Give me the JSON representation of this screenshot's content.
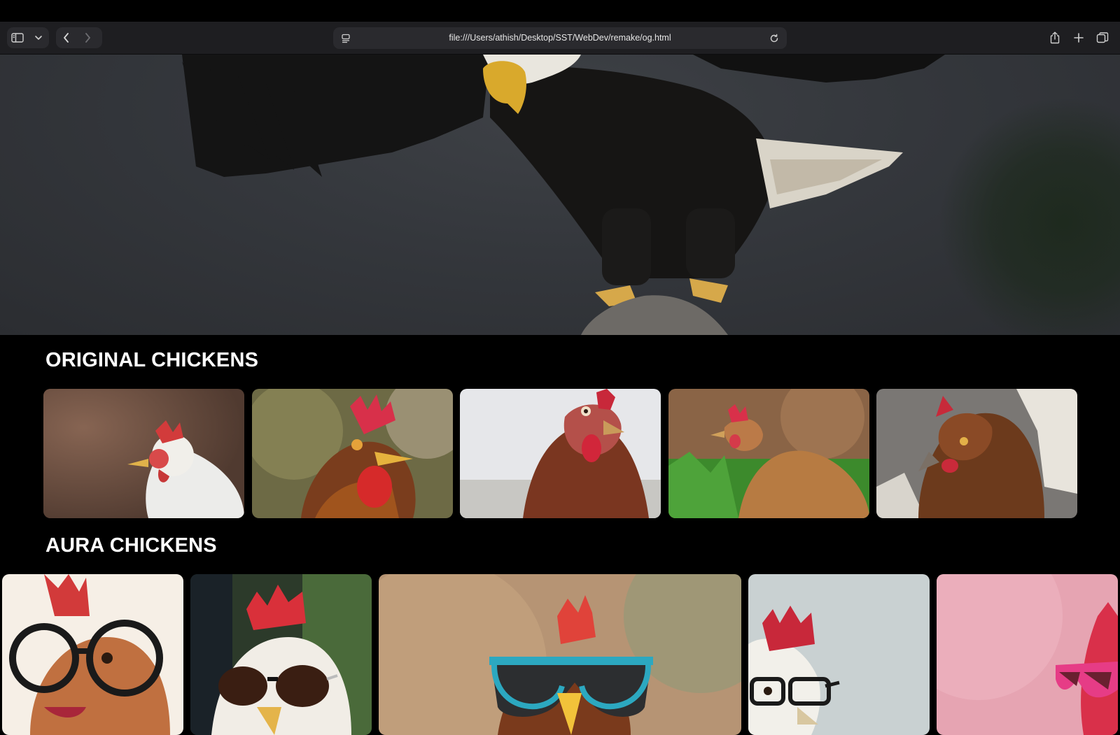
{
  "browser": {
    "url": "file:///Users/athish/Desktop/SST/WebDev/remake/og.html",
    "icons": {
      "sidebar": "sidebar-icon",
      "sidebar_menu": "chevron-down-icon",
      "back": "chevron-left-icon",
      "forward": "chevron-right-icon",
      "page_menu": "page-menu-icon",
      "reload": "reload-icon",
      "share": "share-icon",
      "new_tab": "plus-icon",
      "tab_overview": "tabs-icon"
    }
  },
  "hero": {
    "image": "bald eagle landing on a rock with spread wings"
  },
  "sections": {
    "original": {
      "title": "ORIGINAL CHICKENS",
      "photos": [
        "white speckled hen portrait",
        "red rooster close-up",
        "brown hen against pale sky",
        "brown hen in green grass",
        "brown hen head close-up"
      ]
    },
    "aura": {
      "title": "AURA CHICKENS",
      "photos": [
        "rooster with round glasses",
        "white rooster with dark sunglasses",
        "rooster with blue sunglasses",
        "hen with black-rim glasses",
        "rooster with pink sunglasses"
      ]
    }
  },
  "colors": {
    "page_background": "#000000",
    "toolbar": "#1e1e21",
    "address_bar": "#2a2a2e",
    "heading_text": "#ffffff"
  }
}
